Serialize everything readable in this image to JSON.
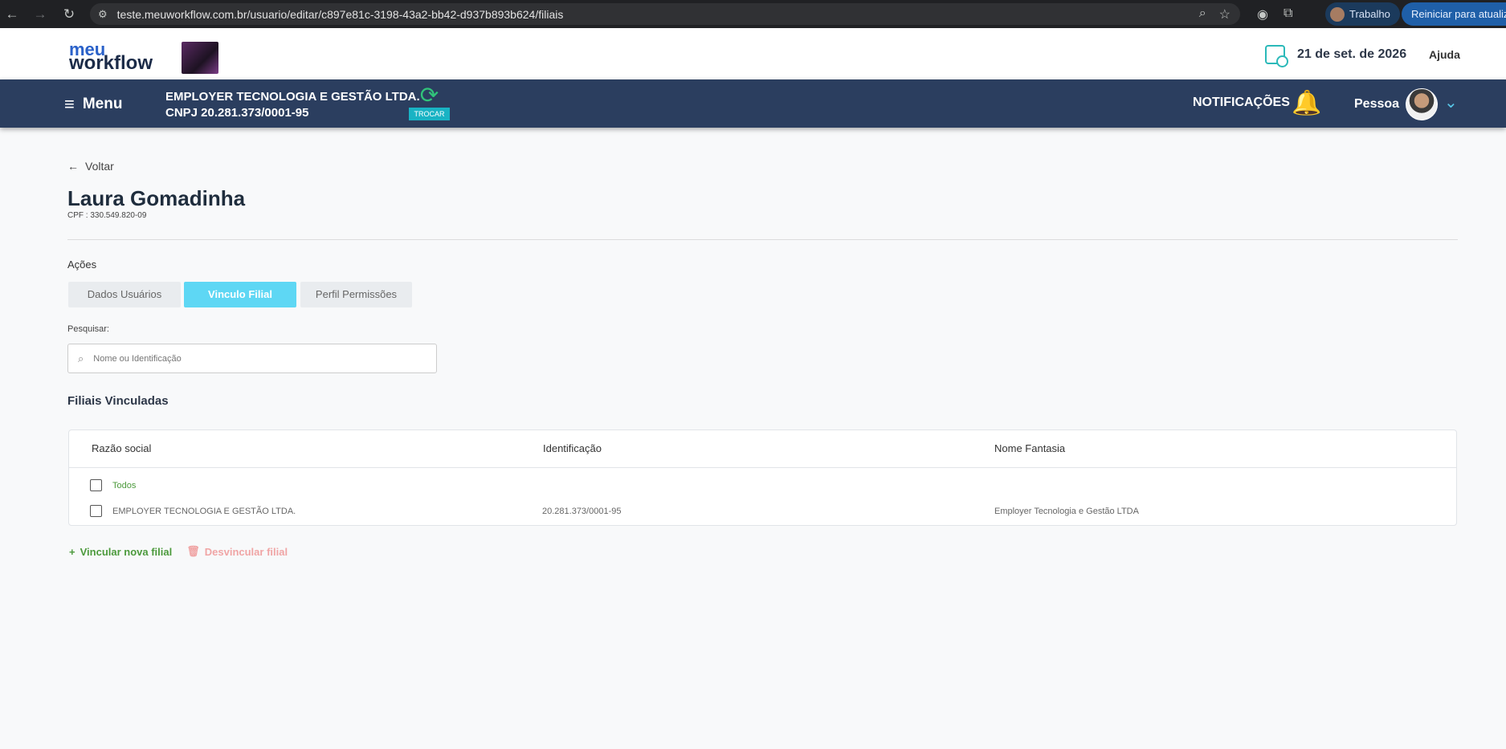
{
  "browser": {
    "url": "teste.meuworkflow.com.br/usuario/editar/c897e81c-3198-43a2-bb42-d937b893b624/filiais",
    "profile_label": "Trabalho",
    "update_label": "Reiniciar para atualizar"
  },
  "header": {
    "logo_line1": "meu",
    "logo_line2": "workflow",
    "date": "21 de set. de 2026",
    "help": "Ajuda"
  },
  "navbar": {
    "menu_label": "Menu",
    "company_name": "EMPLOYER TECNOLOGIA E GESTÃO LTDA.",
    "company_cnpj": "CNPJ 20.281.373/0001-95",
    "switch_label": "TROCAR",
    "notifications_label": "NOTIFICAÇÕES",
    "user_label": "Pessoa"
  },
  "page": {
    "back_label": "Voltar",
    "person_name": "Laura Gomadinha",
    "cpf": "CPF : 330.549.820-09",
    "actions_title": "Ações",
    "tabs": [
      {
        "label": "Dados Usuários"
      },
      {
        "label": "Vinculo Filial"
      },
      {
        "label": "Perfil Permissões"
      }
    ],
    "search_label": "Pesquisar:",
    "search_placeholder": "Nome ou Identificação",
    "section_title": "Filiais Vinculadas",
    "table": {
      "columns": [
        "Razão social",
        "Identificação",
        "Nome Fantasia"
      ],
      "select_all_label": "Todos",
      "rows": [
        {
          "razao": "EMPLOYER TECNOLOGIA E GESTÃO LTDA.",
          "identificacao": "20.281.373/0001-95",
          "fantasia": "Employer Tecnologia e Gestão LTDA"
        }
      ]
    },
    "add_label": "Vincular nova filial",
    "remove_label": "Desvincular filial"
  }
}
